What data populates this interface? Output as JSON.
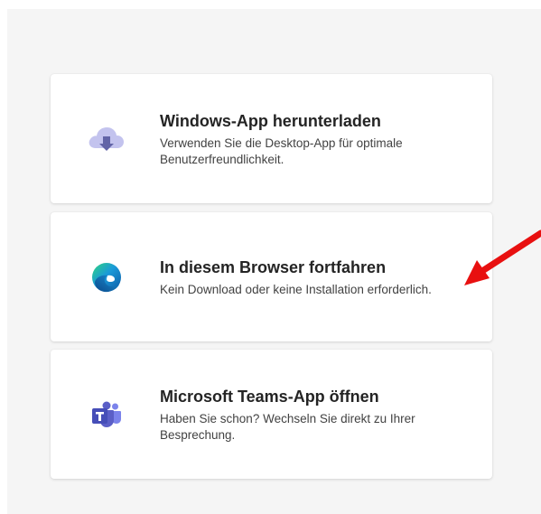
{
  "options": [
    {
      "id": "download",
      "icon": "cloud-download-icon",
      "title": "Windows-App herunterladen",
      "description": "Verwenden Sie die Desktop-App für optimale Benutzerfreundlichkeit."
    },
    {
      "id": "browser",
      "icon": "edge-browser-icon",
      "title": "In diesem Browser fortfahren",
      "description": "Kein Download oder keine Installation erforderlich."
    },
    {
      "id": "teams",
      "icon": "teams-icon",
      "title": "Microsoft Teams-App öffnen",
      "description": "Haben Sie schon? Wechseln Sie direkt zu Ihrer Besprechung."
    }
  ],
  "colors": {
    "panel_bg": "#f5f5f5",
    "card_bg": "#ffffff",
    "cloud": "#b9b8e8",
    "download_arrow": "#6264a7",
    "teams_purple": "#5b5fc7",
    "annotation_arrow": "#e81010"
  }
}
